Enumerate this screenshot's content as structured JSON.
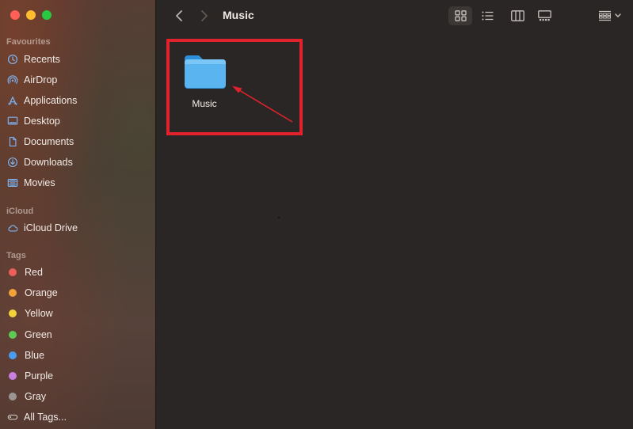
{
  "window": {
    "title": "Music"
  },
  "sidebar": {
    "favourites_title": "Favourites",
    "favourites": [
      {
        "label": "Recents",
        "icon": "clock-icon"
      },
      {
        "label": "AirDrop",
        "icon": "airdrop-icon"
      },
      {
        "label": "Applications",
        "icon": "applications-icon"
      },
      {
        "label": "Desktop",
        "icon": "desktop-icon"
      },
      {
        "label": "Documents",
        "icon": "document-icon"
      },
      {
        "label": "Downloads",
        "icon": "download-icon"
      },
      {
        "label": "Movies",
        "icon": "film-icon"
      }
    ],
    "icloud_title": "iCloud",
    "icloud": [
      {
        "label": "iCloud Drive",
        "icon": "cloud-icon"
      }
    ],
    "tags_title": "Tags",
    "tags": [
      {
        "label": "Red",
        "color": "#ec5f5a"
      },
      {
        "label": "Orange",
        "color": "#f1a33a"
      },
      {
        "label": "Yellow",
        "color": "#f4d23c"
      },
      {
        "label": "Green",
        "color": "#5ecb55"
      },
      {
        "label": "Blue",
        "color": "#4a9cf0"
      },
      {
        "label": "Purple",
        "color": "#c97fe0"
      },
      {
        "label": "Gray",
        "color": "#9b9694"
      }
    ],
    "all_tags": {
      "label": "All Tags...",
      "icon": "tag-outline-icon"
    }
  },
  "toolbar": {
    "back_icon": "chevron-left-icon",
    "forward_icon": "chevron-right-icon",
    "views": [
      "icon-view-icon",
      "list-view-icon",
      "column-view-icon",
      "gallery-view-icon"
    ],
    "group_icon": "group-grid-icon"
  },
  "content": {
    "items": [
      {
        "name": "Music",
        "icon": "folder-icon",
        "color": "#5ab4f0"
      }
    ]
  },
  "annotation": {
    "highlight_color": "#e0222c"
  }
}
